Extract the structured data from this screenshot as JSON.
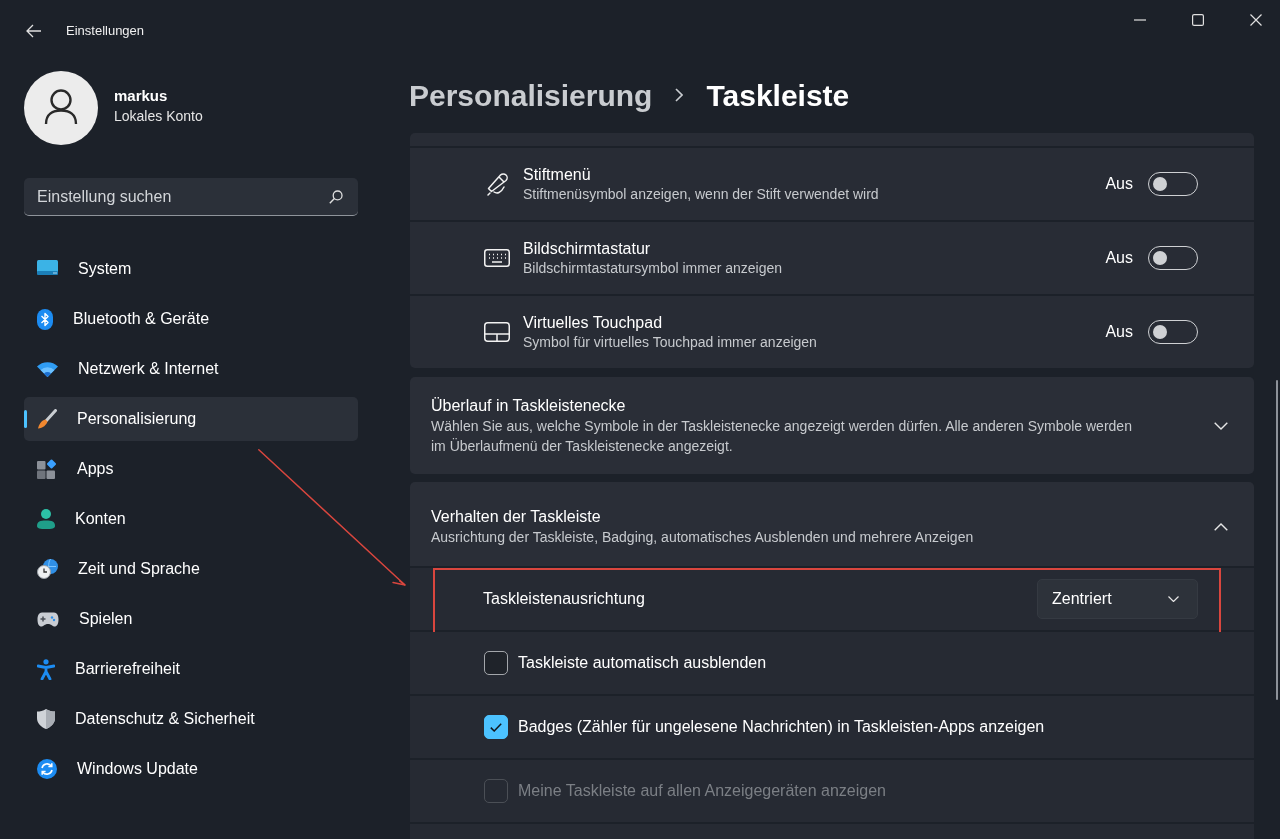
{
  "window": {
    "title": "Einstellungen"
  },
  "account": {
    "name": "markus",
    "type": "Lokales Konto"
  },
  "search": {
    "placeholder": "Einstellung suchen"
  },
  "sidebar": {
    "items": [
      {
        "label": "System",
        "selected": false
      },
      {
        "label": "Bluetooth & Geräte",
        "selected": false
      },
      {
        "label": "Netzwerk & Internet",
        "selected": false
      },
      {
        "label": "Personalisierung",
        "selected": true
      },
      {
        "label": "Apps",
        "selected": false
      },
      {
        "label": "Konten",
        "selected": false
      },
      {
        "label": "Zeit und Sprache",
        "selected": false
      },
      {
        "label": "Spielen",
        "selected": false
      },
      {
        "label": "Barrierefreiheit",
        "selected": false
      },
      {
        "label": "Datenschutz & Sicherheit",
        "selected": false
      },
      {
        "label": "Windows Update",
        "selected": false
      }
    ]
  },
  "breadcrumb": [
    {
      "label": "Personalisierung",
      "current": false
    },
    {
      "label": "Taskleiste",
      "current": true
    }
  ],
  "toggle_settings": [
    {
      "title": "Stiftmenü",
      "description": "Stiftmenüsymbol anzeigen, wenn der Stift verwendet wird",
      "state_label": "Aus",
      "on": false
    },
    {
      "title": "Bildschirmtastatur",
      "description": "Bildschirmtastatursymbol immer anzeigen",
      "state_label": "Aus",
      "on": false
    },
    {
      "title": "Virtuelles Touchpad",
      "description": "Symbol für virtuelles Touchpad immer anzeigen",
      "state_label": "Aus",
      "on": false
    }
  ],
  "sections": [
    {
      "title": "Überlauf in Taskleistenecke",
      "description": "Wählen Sie aus, welche Symbole in der Taskleistenecke angezeigt werden dürfen. Alle anderen Symbole werden im Überlaufmenü der Taskleistenecke angezeigt.",
      "expanded": false
    },
    {
      "title": "Verhalten der Taskleiste",
      "description": "Ausrichtung der Taskleiste, Badging, automatisches Ausblenden und mehrere Anzeigen",
      "expanded": true,
      "items": [
        {
          "kind": "dropdown",
          "label": "Taskleistenausrichtung",
          "value": "Zentriert",
          "highlighted": true
        },
        {
          "kind": "checkbox",
          "label": "Taskleiste automatisch ausblenden",
          "checked": false,
          "disabled": false,
          "highlighted": false
        },
        {
          "kind": "checkbox",
          "label": "Badges (Zähler für ungelesene Nachrichten) in Taskleisten-Apps anzeigen",
          "checked": true,
          "disabled": false,
          "highlighted": false
        },
        {
          "kind": "checkbox",
          "label": "Meine Taskleiste auf allen Anzeigegeräten anzeigen",
          "checked": false,
          "disabled": true,
          "highlighted": false
        }
      ]
    }
  ]
}
